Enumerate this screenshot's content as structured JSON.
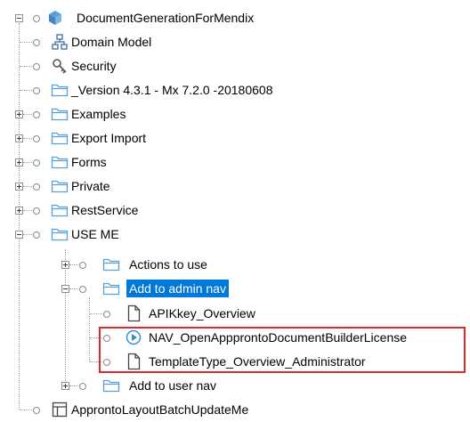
{
  "tree": {
    "root": {
      "label": "DocumentGenerationForMendix",
      "icon": "module-icon"
    },
    "items": [
      {
        "label": "Domain Model",
        "icon": "domain-model-icon"
      },
      {
        "label": "Security",
        "icon": "security-key-icon"
      },
      {
        "label": "_Version 4.3.1 - Mx 7.2.0 -20180608",
        "icon": "folder-icon"
      },
      {
        "label": "Examples",
        "icon": "folder-icon"
      },
      {
        "label": "Export Import",
        "icon": "folder-icon"
      },
      {
        "label": "Forms",
        "icon": "folder-icon"
      },
      {
        "label": "Private",
        "icon": "folder-icon"
      },
      {
        "label": "RestService",
        "icon": "folder-icon"
      },
      {
        "label": "USE ME",
        "icon": "folder-icon"
      }
    ],
    "use_me_children": [
      {
        "label": "Actions to use",
        "icon": "folder-icon"
      },
      {
        "label": "Add to admin nav",
        "icon": "folder-icon",
        "selected": true
      }
    ],
    "admin_nav_children": [
      {
        "label": "APIKkey_Overview",
        "icon": "page-icon"
      },
      {
        "label": "NAV_OpenAppprontoDocumentBuilderLicense",
        "icon": "microflow-icon"
      },
      {
        "label": "TemplateType_Overview_Administrator",
        "icon": "page-icon"
      }
    ],
    "after": [
      {
        "label": "Add to user nav",
        "icon": "folder-icon"
      }
    ],
    "last": {
      "label": "ApprontoLayoutBatchUpdateMe",
      "icon": "layout-icon"
    }
  },
  "colors": {
    "selection": "#0078d7",
    "highlight_box": "#e0292f",
    "folder": "#5aa0d8"
  }
}
